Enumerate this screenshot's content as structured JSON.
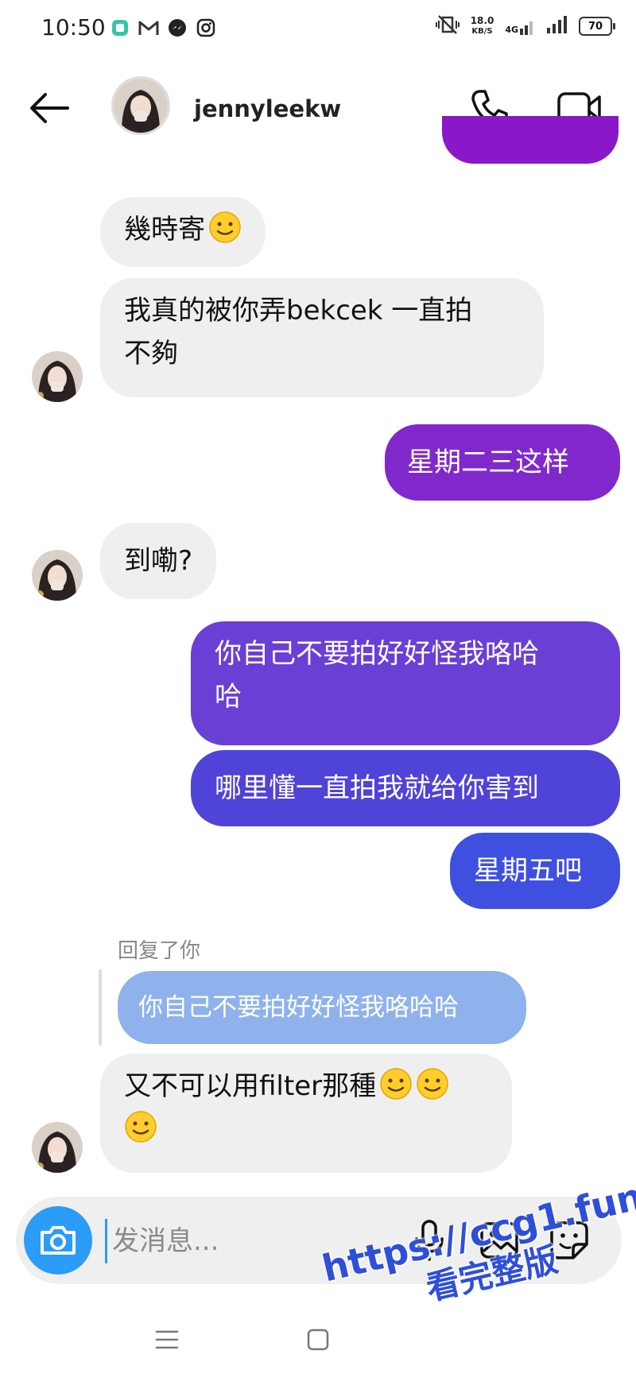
{
  "status_bar": {
    "time": "10:50",
    "speed_value": "18.0",
    "speed_unit": "KB/S",
    "network": "4G",
    "battery": "70"
  },
  "header": {
    "username": "jennyleekw"
  },
  "messages": [
    {
      "side": "incoming",
      "text": "幾時寄",
      "emojis": 1
    },
    {
      "side": "incoming",
      "line1": "我真的被你弄bekcek 一直拍",
      "line2": "不夠"
    },
    {
      "side": "outgoing",
      "text": "星期二三这样"
    },
    {
      "side": "incoming",
      "text": "到嘞?"
    },
    {
      "side": "outgoing",
      "line1": "你自己不要拍好好怪我咯哈",
      "line2": "哈"
    },
    {
      "side": "outgoing",
      "text": "哪里懂一直拍我就给你害到"
    },
    {
      "side": "outgoing",
      "text": "星期五吧"
    },
    {
      "side": "incoming",
      "line1": "又不可以用filter那種",
      "emojis": 3
    }
  ],
  "reply": {
    "label": "回复了你",
    "quoted": "你自己不要拍好好怪我咯哈哈"
  },
  "composer": {
    "placeholder": "发消息..."
  },
  "colors": {
    "incoming_bg": "#efefef",
    "out_purple": "#8a2fd0",
    "out_violet": "#6a3fd6",
    "out_indigo": "#5043d8",
    "out_blue": "#3f4fe0",
    "reply_quote_bg": "#8fb2ec",
    "camera_blue": "#2b9cf7"
  },
  "watermark": {
    "url": "https://ccg1.fun",
    "subtitle": "看完整版"
  }
}
